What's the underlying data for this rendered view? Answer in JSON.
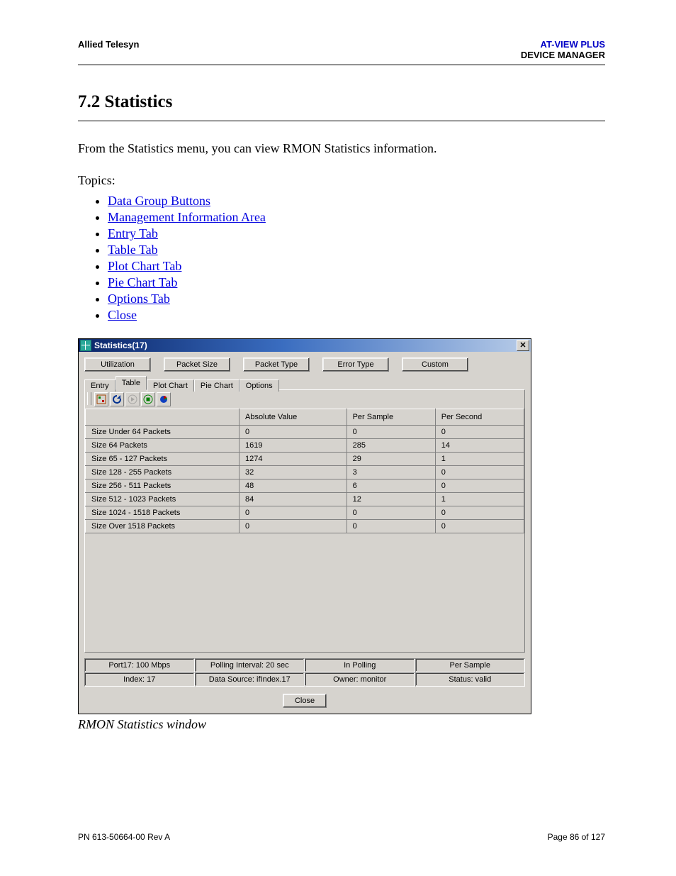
{
  "header": {
    "left": "Allied Telesyn",
    "product": "AT-VIEW PLUS",
    "subproduct": "DEVICE MANAGER"
  },
  "section": {
    "title": "7.2 Statistics"
  },
  "intro": "From the Statistics menu, you can view RMON Statistics information.",
  "topics_label": "Topics:",
  "topics": [
    "Data Group Buttons",
    "Management Information Area",
    "Entry Tab",
    "Table Tab",
    "Plot Chart Tab",
    "Pie Chart Tab",
    "Options Tab",
    "Close"
  ],
  "dialog": {
    "title": "Statistics(17)",
    "group_buttons": [
      "Utilization",
      "Packet Size",
      "Packet Type",
      "Error Type",
      "Custom"
    ],
    "tabs": [
      "Entry",
      "Table",
      "Plot Chart",
      "Pie Chart",
      "Options"
    ],
    "active_tab": "Table",
    "toolbar_icons": [
      "export-icon",
      "refresh-icon",
      "play-icon",
      "stop-icon",
      "pie-icon"
    ],
    "columns": [
      "",
      "Absolute Value",
      "Per Sample",
      "Per Second"
    ],
    "rows": [
      {
        "label": "Size Under 64 Packets",
        "abs": "0",
        "sample": "0",
        "sec": "0"
      },
      {
        "label": "Size 64 Packets",
        "abs": "1619",
        "sample": "285",
        "sec": "14"
      },
      {
        "label": "Size 65 - 127 Packets",
        "abs": "1274",
        "sample": "29",
        "sec": "1"
      },
      {
        "label": "Size 128 - 255 Packets",
        "abs": "32",
        "sample": "3",
        "sec": "0"
      },
      {
        "label": "Size 256 - 511 Packets",
        "abs": "48",
        "sample": "6",
        "sec": "0"
      },
      {
        "label": "Size 512 - 1023 Packets",
        "abs": "84",
        "sample": "12",
        "sec": "1"
      },
      {
        "label": "Size 1024 - 1518 Packets",
        "abs": "0",
        "sample": "0",
        "sec": "0"
      },
      {
        "label": "Size Over 1518 Packets",
        "abs": "0",
        "sample": "0",
        "sec": "0"
      }
    ],
    "status": {
      "row1": [
        "Port17: 100 Mbps",
        "Polling Interval: 20 sec",
        "In Polling",
        "Per Sample"
      ],
      "row2": [
        "Index: 17",
        "Data Source: ifIndex.17",
        "Owner: monitor",
        "Status: valid"
      ]
    },
    "close": "Close"
  },
  "caption": "RMON Statistics window",
  "footer": {
    "left": "PN 613-50664-00 Rev A",
    "right": "Page 86 of 127"
  }
}
